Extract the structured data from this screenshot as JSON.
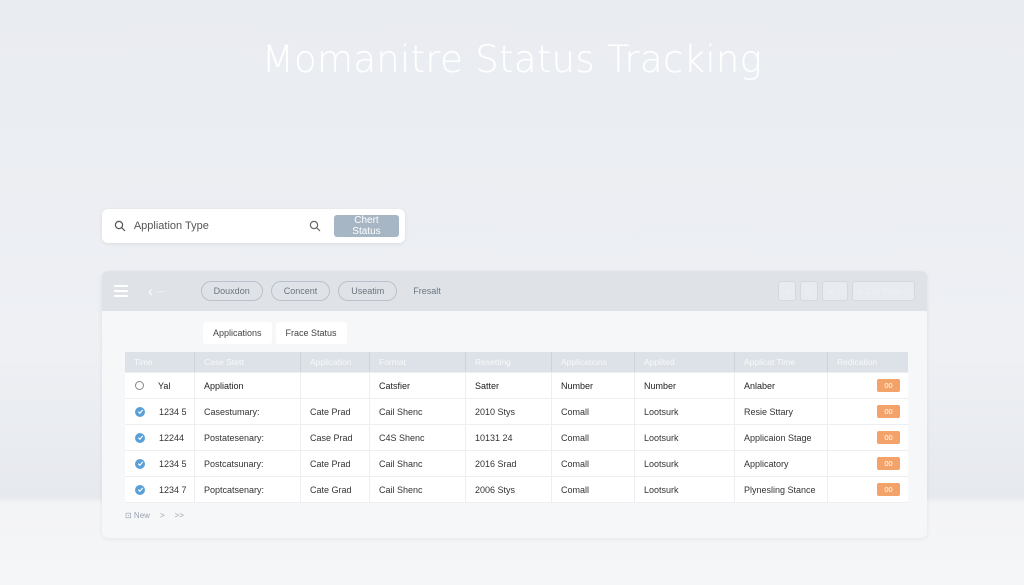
{
  "page": {
    "title": "Momanitre Status Tracking"
  },
  "search": {
    "placeholder": "Appliation Type",
    "button_label": "Chert Status"
  },
  "toolbar": {
    "back_sub": "—",
    "pills": [
      "Douxdon",
      "Concent",
      "Useatim"
    ],
    "plain": "Fresalt",
    "right_buttons": [
      "≑",
      "⎙",
      "⊗ ⌄",
      "⊕ Cue Roas ⌄"
    ]
  },
  "tabs": [
    "Applications",
    "Frace Status"
  ],
  "table": {
    "headers": [
      "Time",
      "Case Stett",
      "Application",
      "Format",
      "Resetting",
      "Applications",
      "Applited",
      "Applicat Time",
      "Redication"
    ],
    "rows": [
      {
        "marker": "radio",
        "cells": [
          "Yal",
          "Appliation",
          "",
          "Catsfier",
          "Satter",
          "Number",
          "Number",
          "Anlaber"
        ],
        "tag": "00"
      },
      {
        "marker": "check",
        "cells": [
          "1234 5",
          "Casestumary:",
          "Cate Prad",
          "Cail Shenc",
          "2010 Stys",
          "Comall",
          "Lootsurk",
          "Resie Sttary"
        ],
        "tag": "00"
      },
      {
        "marker": "check",
        "cells": [
          "12244",
          "Postatesenary:",
          "Case Prad",
          "C4S Shenc",
          "10131 24",
          "Comall",
          "Lootsurk",
          "Applicaion Stage"
        ],
        "tag": "00"
      },
      {
        "marker": "check",
        "cells": [
          "1234 5",
          "Postcatsunary:",
          "Cate Prad",
          "Cail Shanc",
          "2016 Srad",
          "Comall",
          "Lootsurk",
          "Applicatory"
        ],
        "tag": "00"
      },
      {
        "marker": "check",
        "cells": [
          "1234 7",
          "Poptcatsenary:",
          "Cate Grad",
          "Cail Shenc",
          "2006 Stys",
          "Comall",
          "Lootsurk",
          "Plynesling Stance"
        ],
        "tag": "00"
      }
    ]
  },
  "pager": {
    "items": [
      "⊡ New",
      ">",
      ">>"
    ]
  },
  "colors": {
    "accent": "#5aa0d8",
    "tag": "#f3a36a",
    "check_button": "#a7b6c4"
  }
}
